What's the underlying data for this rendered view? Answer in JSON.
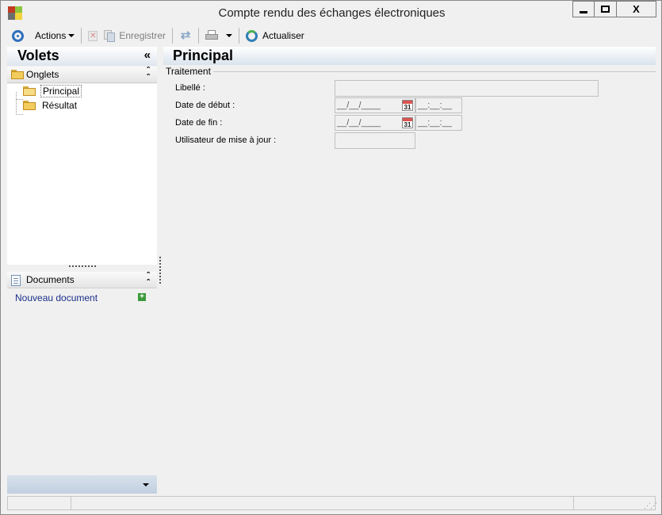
{
  "window": {
    "title": "Compte rendu des échanges électroniques",
    "controls": {
      "minimize": "minimize",
      "maximize": "maximize",
      "close": "X"
    }
  },
  "toolbar": {
    "actions_label": "Actions",
    "save_label": "Enregistrer",
    "refresh_label": "Actualiser"
  },
  "left_panel": {
    "title": "Volets",
    "collapse_glyph": "«",
    "tabs_section": {
      "label": "Onglets",
      "items": [
        {
          "label": "Principal",
          "selected": true
        },
        {
          "label": "Résultat",
          "selected": false
        }
      ]
    },
    "documents_section": {
      "label": "Documents",
      "new_document": "Nouveau document"
    }
  },
  "main": {
    "title": "Principal",
    "group": "Traitement",
    "fields": {
      "libelle_label": "Libellé :",
      "libelle_value": "",
      "start_date_label": "Date de début :",
      "start_date_value": "__/__/____",
      "start_time_value": "__:__:__",
      "end_date_label": "Date de fin :",
      "end_date_value": "__/__/____",
      "end_time_value": "__:__:__",
      "user_label": "Utilisateur de mise à jour :",
      "user_value": ""
    },
    "calendar_day": "31"
  },
  "colors": {
    "header_gradient": "#d9e2ec",
    "accent_blue": "#2e6fbd",
    "link": "#1a2f8a"
  }
}
